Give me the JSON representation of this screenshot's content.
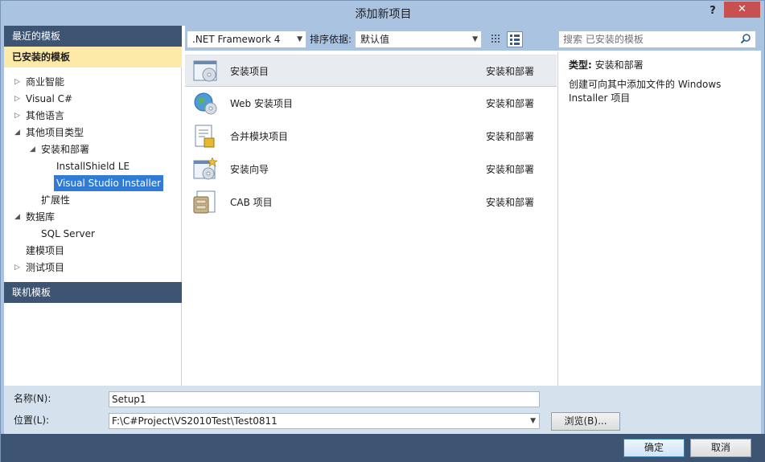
{
  "window": {
    "title": "添加新项目",
    "help": "?",
    "close": "✕"
  },
  "left": {
    "recent_header": "最近的模板",
    "installed_header": "已安装的模板",
    "online_header": "联机模板",
    "tree": [
      {
        "label": "商业智能",
        "arrow": "▷"
      },
      {
        "label": "Visual C#",
        "arrow": "▷"
      },
      {
        "label": "其他语言",
        "arrow": "▷"
      },
      {
        "label": "其他项目类型",
        "arrow": "◢"
      },
      {
        "label": "安装和部署",
        "arrow": "◢"
      },
      {
        "label": "InstallShield LE",
        "arrow": ""
      },
      {
        "label": "Visual Studio Installer",
        "arrow": "",
        "selected": true
      },
      {
        "label": "扩展性",
        "arrow": ""
      },
      {
        "label": "数据库",
        "arrow": "◢"
      },
      {
        "label": "SQL Server",
        "arrow": ""
      },
      {
        "label": "建模项目",
        "arrow": ""
      },
      {
        "label": "测试项目",
        "arrow": "▷"
      }
    ]
  },
  "toolbar": {
    "framework": ".NET Framework 4",
    "sort_label": "排序依据:",
    "sort_value": "默认值",
    "search_placeholder": "搜索 已安装的模板"
  },
  "templates": [
    {
      "name": "安装项目",
      "category": "安装和部署",
      "icon": "setup-project-icon",
      "selected": true
    },
    {
      "name": "Web 安装项目",
      "category": "安装和部署",
      "icon": "web-setup-project-icon"
    },
    {
      "name": "合并模块项目",
      "category": "安装和部署",
      "icon": "merge-module-icon"
    },
    {
      "name": "安装向导",
      "category": "安装和部署",
      "icon": "setup-wizard-icon"
    },
    {
      "name": "CAB 项目",
      "category": "安装和部署",
      "icon": "cab-project-icon"
    }
  ],
  "description": {
    "type_label": "类型:",
    "type_value": "安装和部署",
    "text": "创建可向其中添加文件的 Windows Installer 项目"
  },
  "form": {
    "name_label": "名称(N):",
    "name_value": "Setup1",
    "location_label": "位置(L):",
    "location_value": "F:\\C#Project\\VS2010Test\\Test0811",
    "browse_label": "浏览(B)..."
  },
  "footer": {
    "ok_label": "确定",
    "cancel_label": "取消"
  },
  "colors": {
    "accent": "#2f7bd6",
    "header": "#3e5473",
    "selected": "#fde9a8",
    "close": "#c75050"
  }
}
